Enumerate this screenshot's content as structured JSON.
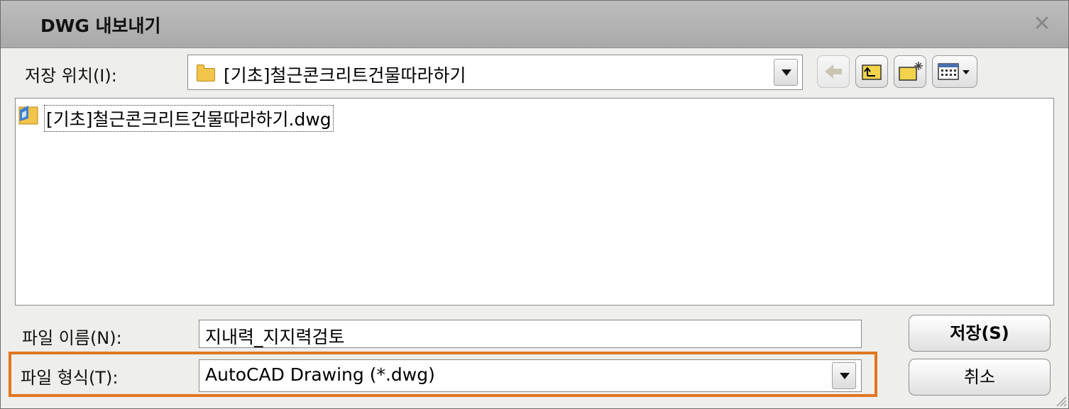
{
  "window": {
    "title": "DWG 내보내기"
  },
  "location": {
    "label": "저장 위치(I):",
    "value": "[기초]철근콘크리트건물따라하기",
    "folder_icon": "folder-icon"
  },
  "toolbar": {
    "back_icon": "back-arrow-icon",
    "up_icon": "up-folder-icon",
    "new_folder_icon": "new-folder-icon",
    "view_menu_icon": "view-menu-icon"
  },
  "files": [
    {
      "name": "[기초]철근콘크리트건물따라하기.dwg",
      "icon": "dwg-file-icon"
    }
  ],
  "filename": {
    "label": "파일 이름(N):",
    "value": "지내력_지지력검토"
  },
  "filetype": {
    "label": "파일 형식(T):",
    "value": "AutoCAD Drawing (*.dwg)"
  },
  "buttons": {
    "save": "저장(S)",
    "cancel": "취소"
  },
  "colors": {
    "highlight": "#e0761e",
    "titlebar": "#b0b0b0",
    "folder": "#f2c449"
  }
}
